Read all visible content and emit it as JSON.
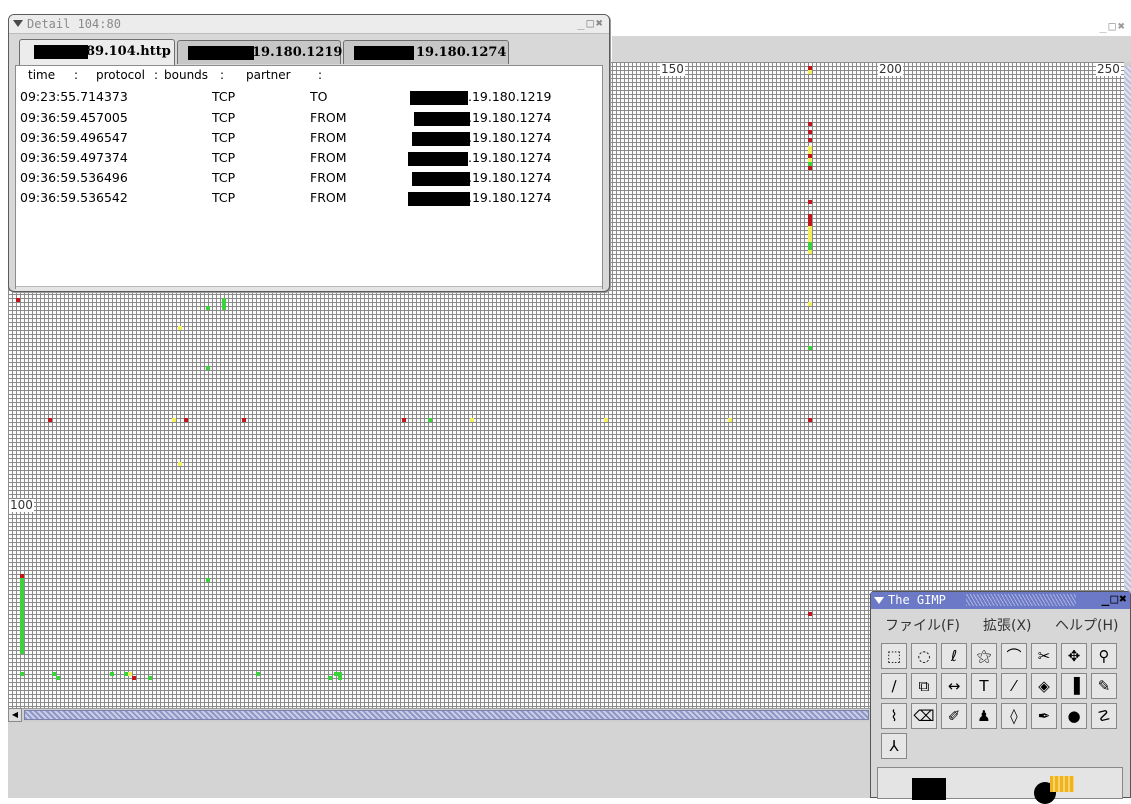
{
  "detail_window": {
    "title": "Detail 104:80",
    "window_buttons": "_□✖",
    "tabs": [
      {
        "label": "89.104.http",
        "active": true
      },
      {
        "label": "19.180.1219",
        "active": false
      },
      {
        "label": "19.180.1274",
        "active": false
      }
    ],
    "columns": [
      "time",
      "protocol",
      "bounds",
      "partner"
    ],
    "column_separator": ":",
    "rows": [
      {
        "time": "09:23:55.714373",
        "protocol": "TCP",
        "bounds": "TO",
        "partner": ".19.180.1219"
      },
      {
        "time": "09:36:59.457005",
        "protocol": "TCP",
        "bounds": "FROM",
        "partner": ".19.180.1274"
      },
      {
        "time": "09:36:59.496547",
        "protocol": "TCP",
        "bounds": "FROM",
        "partner": ".19.180.1274"
      },
      {
        "time": "09:36:59.497374",
        "protocol": "TCP",
        "bounds": "FROM",
        "partner": ".19.180.1274"
      },
      {
        "time": "09:36:59.536496",
        "protocol": "TCP",
        "bounds": "FROM",
        "partner": ".19.180.1274"
      },
      {
        "time": "09:36:59.536542",
        "protocol": "TCP",
        "bounds": "FROM",
        "partner": ".19.180.1274"
      }
    ]
  },
  "grid_window": {
    "window_buttons": "_□✖",
    "axis_labels": {
      "x150": "150",
      "x200": "200",
      "x250": "250",
      "y100": "100"
    },
    "colors": {
      "red": "#c3141c",
      "green": "#3bd23b",
      "yellow": "#f4f05a",
      "grid_line": "#8b8b8b"
    }
  },
  "gimp": {
    "title": "The GIMP",
    "window_buttons": "_□✖",
    "menu": {
      "file": "ファイル(F)",
      "extensions": "拡張(X)",
      "help": "ヘルプ(H)"
    },
    "tools": [
      {
        "name": "rect-select-icon",
        "glyph": "⬚"
      },
      {
        "name": "ellipse-select-icon",
        "glyph": "◌"
      },
      {
        "name": "lasso-icon",
        "glyph": "ℓ"
      },
      {
        "name": "magic-wand-icon",
        "glyph": "⚝"
      },
      {
        "name": "bezier-select-icon",
        "glyph": "⌒"
      },
      {
        "name": "intelligent-scissors-icon",
        "glyph": "✂"
      },
      {
        "name": "move-icon",
        "glyph": "✥"
      },
      {
        "name": "zoom-icon",
        "glyph": "⚲"
      },
      {
        "name": "measure-icon",
        "glyph": "∕"
      },
      {
        "name": "crop-icon",
        "glyph": "⧉"
      },
      {
        "name": "flip-icon",
        "glyph": "↔"
      },
      {
        "name": "text-icon",
        "glyph": "T"
      },
      {
        "name": "color-picker-icon",
        "glyph": "⁄"
      },
      {
        "name": "bucket-fill-icon",
        "glyph": "◈"
      },
      {
        "name": "gradient-icon",
        "glyph": "▐"
      },
      {
        "name": "pencil-icon",
        "glyph": "✎"
      },
      {
        "name": "paintbrush-icon",
        "glyph": "⌇"
      },
      {
        "name": "eraser-icon",
        "glyph": "⌫"
      },
      {
        "name": "airbrush-icon",
        "glyph": "✐"
      },
      {
        "name": "clone-icon",
        "glyph": "♟"
      },
      {
        "name": "blur-icon",
        "glyph": "◊"
      },
      {
        "name": "ink-icon",
        "glyph": "✒"
      },
      {
        "name": "dodge-burn-icon",
        "glyph": "●"
      },
      {
        "name": "smudge-icon",
        "glyph": "☡"
      },
      {
        "name": "heal-icon",
        "glyph": "⅄"
      }
    ]
  }
}
